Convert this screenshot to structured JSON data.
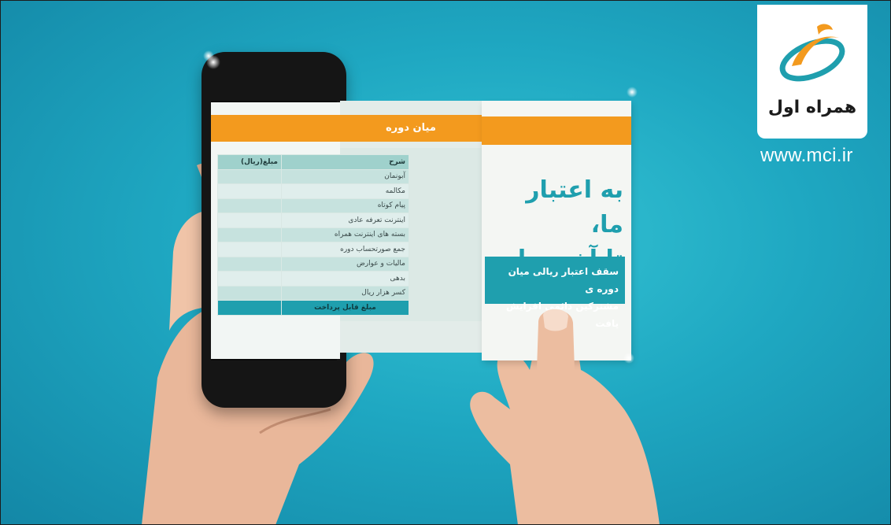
{
  "logo": {
    "text": "همراه اول",
    "icon": "mci-swoosh-logo",
    "colors": {
      "orange": "#f39a1e",
      "teal": "#1f9fae"
    }
  },
  "site_url": "www.mci.ir",
  "brochure": {
    "middle_title": "میان دوره",
    "headline_line1": "به اعتبار ما،",
    "headline_line2": "تا آخـر ماه",
    "sub_line1": "سقف اعتبار ریالی میان دوره ی",
    "sub_line2": "مشترکین دائمی افزایش یافت",
    "table": {
      "header_desc": "شرح",
      "header_amount": "مبلغ(ریال)",
      "rows": [
        "آبونمان",
        "مکالمه",
        "پیام کوتاه",
        "اینترنت تعرفه عادی",
        "بسته های اینترنت همراه",
        "جمع صورتحساب دوره",
        "مالیات و عوارض",
        "بدهی",
        "کسر هزار ریال"
      ],
      "total": "مبلغ قابل پرداخت"
    }
  }
}
